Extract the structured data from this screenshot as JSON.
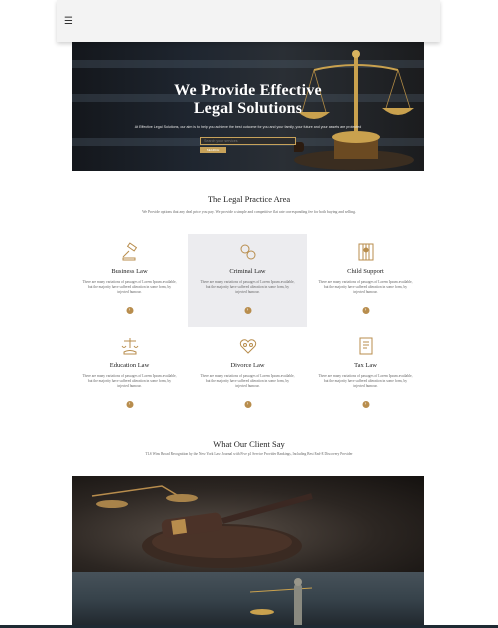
{
  "nav": {
    "menu_icon": "hamburger-icon",
    "menu_glyph": "☰"
  },
  "hero": {
    "title_line1": "We Provide Effective",
    "title_line2": "Legal Solutions",
    "subtitle": "At Effective Legal Solutions, our aim is to help you achieve the best outcome for you and your family, your future and your assets are protected",
    "search_placeholder": "Search your services",
    "search_button": "SEARCH"
  },
  "practice": {
    "title": "The Legal Practice Area",
    "subtitle": "We Provide options that any deal price you pay. We provide a simple and competitive flat rate corresponding fee for both buying and selling.",
    "services": [
      {
        "name": "Business Law",
        "icon": "gavel-icon",
        "desc": "There are many variations of passages of Lorem Ipsum available, but the majority have suffered alteration in some form, by injected humour."
      },
      {
        "name": "Criminal Law",
        "icon": "handcuffs-icon",
        "desc": "There are many variations of passages of Lorem Ipsum available, but the majority have suffered alteration in some form, by injected humour."
      },
      {
        "name": "Child Support",
        "icon": "child-icon",
        "desc": "There are many variations of passages of Lorem Ipsum available, but the majority have suffered alteration in some form, by injected humour."
      },
      {
        "name": "Education Law",
        "icon": "scales-hand-icon",
        "desc": "There are many variations of passages of Lorem Ipsum available, but the majority have suffered alteration in some form, by injected humour."
      },
      {
        "name": "Divorce Law",
        "icon": "broken-heart-icon",
        "desc": "There are many variations of passages of Lorem Ipsum available, but the majority have suffered alteration in some form, by injected humour."
      },
      {
        "name": "Tax Law",
        "icon": "tax-document-icon",
        "desc": "There are many variations of passages of Lorem Ipsum available, but the majority have suffered alteration in some form, by injected humour."
      }
    ],
    "more_glyph": "›"
  },
  "clients": {
    "title": "What Our Client Say",
    "subtitle": "TLS Wins Broad Recognition by the New York Law Journal with Five p1 Service Provider Rankings, Including Best End-E Discovery Provider"
  },
  "colors": {
    "accent": "#b88d4d",
    "hero_bg": "#1f2630",
    "active_card": "#ececef"
  }
}
